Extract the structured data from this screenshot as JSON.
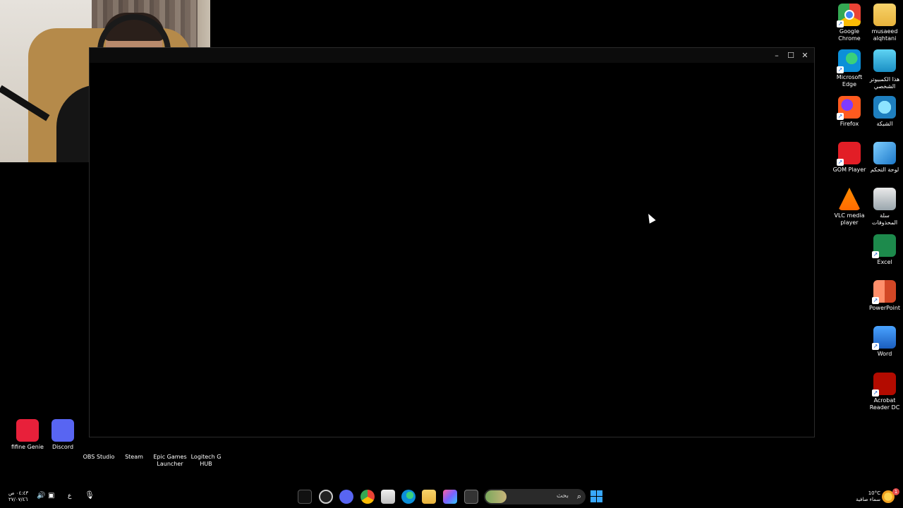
{
  "desktop_icons_right": [
    {
      "label": "Google\nChrome",
      "icon": "chrome-icon"
    },
    {
      "label": "musaeed\nalqhtani",
      "icon": "folder-icon"
    },
    {
      "label": "Microsoft\nEdge",
      "icon": "edge-icon"
    },
    {
      "label": "هذا الكمبيوتر\nالشخصي",
      "icon": "this-pc-icon"
    },
    {
      "label": "Firefox",
      "icon": "firefox-icon"
    },
    {
      "label": "الشبكة",
      "icon": "network-icon"
    },
    {
      "label": "GOM Player",
      "icon": "gom-player-icon"
    },
    {
      "label": "لوحة التحكم",
      "icon": "control-panel-icon"
    },
    {
      "label": "VLC media\nplayer",
      "icon": "vlc-icon"
    },
    {
      "label": "سلة\nالمحذوفات",
      "icon": "recycle-bin-icon"
    },
    {
      "label": "Excel",
      "icon": "excel-icon"
    },
    {
      "label": "PowerPoint",
      "icon": "powerpoint-icon"
    },
    {
      "label": "Word",
      "icon": "word-icon"
    },
    {
      "label": "Acrobat\nReader DC",
      "icon": "acrobat-icon"
    }
  ],
  "desktop_icons_bottom": [
    {
      "label": "fifine Genie",
      "icon": "fifine-genie-icon"
    },
    {
      "label": "Discord",
      "icon": "discord-icon"
    },
    {
      "label": "OBS Studio",
      "icon": "obs-icon"
    },
    {
      "label": "Steam",
      "icon": "steam-icon"
    },
    {
      "label": "Epic Games\nLauncher",
      "icon": "epic-games-icon"
    },
    {
      "label": "Logitech G\nHUB",
      "icon": "logitech-icon"
    }
  ],
  "taskbar": {
    "clock_time": "٠٤:٤٣ ص",
    "clock_date": "٢٧/٠٧/٤٦",
    "input_lang": "ع",
    "search_placeholder": "بحث",
    "weather_temp": "10°C",
    "weather_desc": "سماء صافية",
    "notification_count": "1",
    "pinned_apps": [
      "epic-games-icon",
      "obs-icon",
      "discord-icon",
      "chrome-icon",
      "store-icon",
      "edge-icon",
      "file-explorer-icon",
      "copilot-icon",
      "task-view-icon"
    ]
  },
  "window_controls": {
    "minimize": "–",
    "maximize": "☐",
    "close": "✕"
  },
  "colors": {
    "start": "#38a8ff",
    "taskbar": "#000000",
    "desktop": "#000000"
  }
}
